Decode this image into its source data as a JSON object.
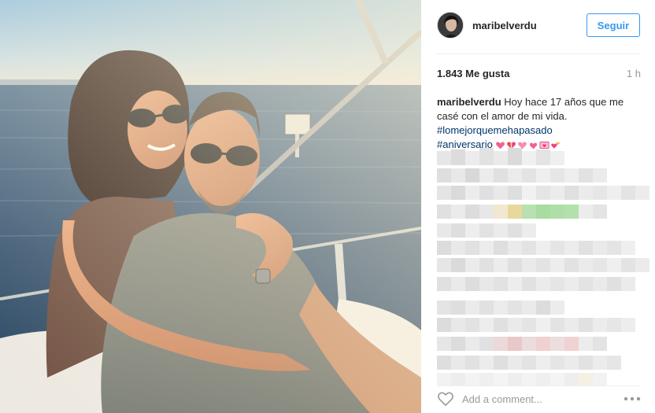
{
  "post": {
    "username": "maribelverdu",
    "follow_label": "Seguir",
    "likes": "1.843 Me gusta",
    "time": "1 h",
    "caption": {
      "username": "maribelverdu",
      "text": "Hoy hace 17 años que me casé con el amor de mi vida.",
      "hashtags": [
        "#lomejorquemehapasado",
        "#aniversario"
      ]
    },
    "emojis": [
      "sparkling-heart-icon",
      "gift-heart-icon",
      "heart-icon",
      "heart-icon",
      "love-letter-icon",
      "revolving-hearts-icon"
    ],
    "comment_placeholder": "Add a comment...",
    "icons": {
      "like": "heart-outline-icon",
      "more": "more-options-icon"
    }
  },
  "colors": {
    "accent_blue": "#3897f0",
    "hashtag": "#003569",
    "muted": "#999999",
    "emoji_pink": "#f06292"
  }
}
